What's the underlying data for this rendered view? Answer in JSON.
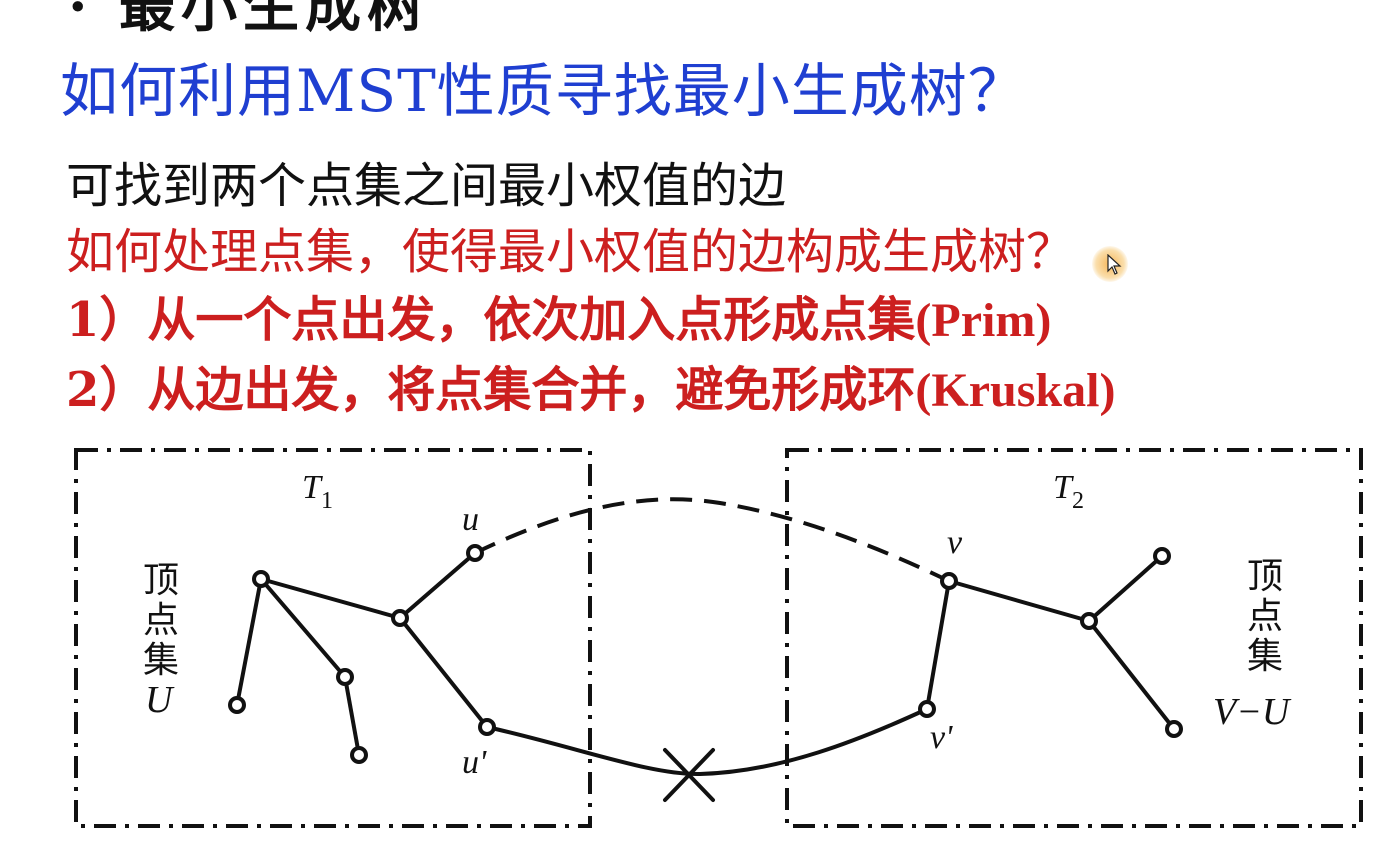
{
  "slide": {
    "top_fragment": "· 最小生成树",
    "heading": "如何利用MST性质寻找最小生成树？",
    "line1": "可找到两个点集之间最小权值的边",
    "line2": "如何处理点集，使得最小权值的边构成生成树？",
    "line3_prefix": "1）从一个点出发，依次加入点形成点集",
    "line3_suffix": "(Prim)",
    "line4_prefix": "2）从边出发，将点集合并，避免形成环",
    "line4_suffix": "(Kruskal)"
  },
  "diagram": {
    "left_tree_label": "T",
    "left_tree_sub": "1",
    "right_tree_label": "T",
    "right_tree_sub": "2",
    "left_set_chars": [
      "顶",
      "点",
      "集"
    ],
    "left_set_symbol": "U",
    "right_set_chars": [
      "顶",
      "点",
      "集"
    ],
    "right_set_symbol": "V−U",
    "vertex_u": "u",
    "vertex_u_prime": "u'",
    "vertex_v": "v",
    "vertex_v_prime": "v'"
  },
  "colors": {
    "heading": "#1f3fd1",
    "emphasis": "#cc1f1f",
    "text": "#111111"
  }
}
